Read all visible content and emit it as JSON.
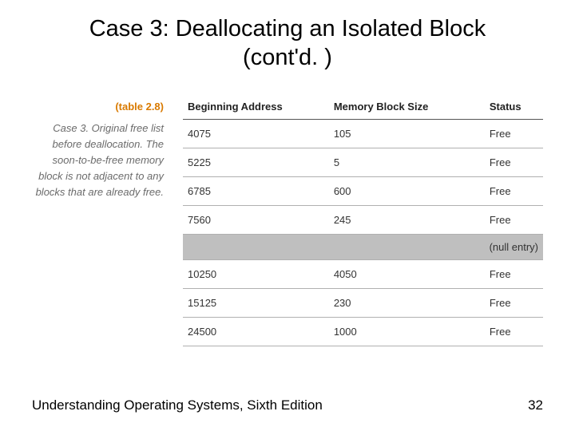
{
  "title_line1": "Case 3: Deallocating an Isolated Block",
  "title_line2": "(cont'd. )",
  "table_label": "(table 2.8)",
  "caption": "Case 3. Original free list before deallocation. The soon-to-be-free memory block is not adjacent to any blocks that are already free.",
  "columns": {
    "addr": "Beginning Address",
    "size": "Memory Block Size",
    "status": "Status"
  },
  "rows": [
    {
      "addr": "4075",
      "size": "105",
      "status": "Free",
      "null": false
    },
    {
      "addr": "5225",
      "size": "5",
      "status": "Free",
      "null": false
    },
    {
      "addr": "6785",
      "size": "600",
      "status": "Free",
      "null": false
    },
    {
      "addr": "7560",
      "size": "245",
      "status": "Free",
      "null": false
    },
    {
      "addr": "",
      "size": "",
      "status": "(null entry)",
      "null": true
    },
    {
      "addr": "10250",
      "size": "4050",
      "status": "Free",
      "null": false
    },
    {
      "addr": "15125",
      "size": "230",
      "status": "Free",
      "null": false
    },
    {
      "addr": "24500",
      "size": "1000",
      "status": "Free",
      "null": false
    }
  ],
  "footer_text": "Understanding Operating Systems, Sixth Edition",
  "page_number": "32"
}
